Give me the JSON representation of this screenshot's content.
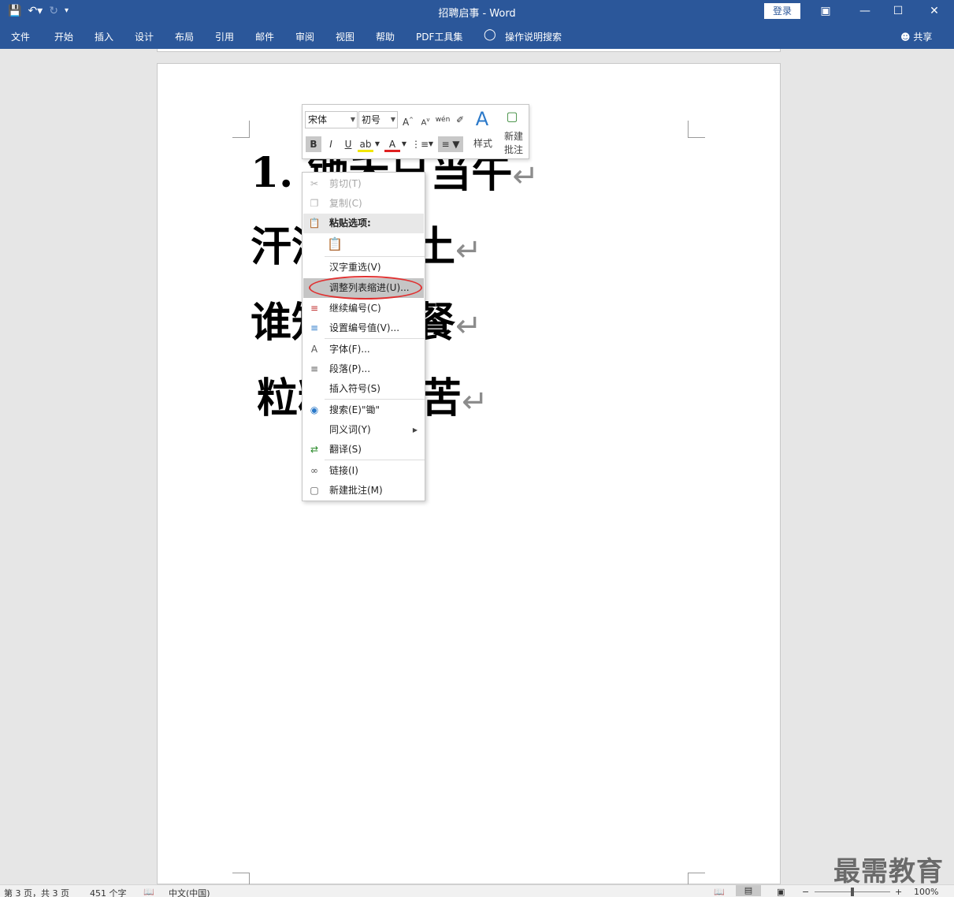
{
  "title_bar": {
    "document_title": "招聘启事  -  Word",
    "login_label": "登录",
    "quick_access": [
      "save-icon",
      "undo-icon",
      "redo-icon",
      "customize-icon"
    ],
    "window_controls": [
      "ribbon-display-icon",
      "minimize-icon",
      "maximize-icon",
      "close-icon"
    ]
  },
  "ribbon": {
    "tabs": [
      "文件",
      "开始",
      "插入",
      "设计",
      "布局",
      "引用",
      "邮件",
      "审阅",
      "视图",
      "帮助",
      "PDF工具集"
    ],
    "tell_me": "操作说明搜索",
    "share": "共享"
  },
  "document": {
    "lines": [
      {
        "text": "1.  锄禾日当午"
      },
      {
        "text": "汗滴禾下土"
      },
      {
        "text": "谁知盘中餐"
      },
      {
        "text": "粒粒皆辛苦"
      }
    ],
    "return_mark": "↵"
  },
  "mini_toolbar": {
    "font_name": "宋体",
    "font_size": "初号",
    "styles_label": "样式",
    "new_comment_label_1": "新建",
    "new_comment_label_2": "批注"
  },
  "context_menu": {
    "items": [
      {
        "label": "剪切(T)",
        "icon": "scissors-icon",
        "disabled": true
      },
      {
        "label": "复制(C)",
        "icon": "copy-icon",
        "disabled": true
      },
      {
        "label": "粘贴选项:",
        "icon": "paste-icon",
        "section": true
      },
      {
        "label": "汉字重选(V)",
        "icon": ""
      },
      {
        "label": "调整列表缩进(U)...",
        "icon": "",
        "highlighted": true
      },
      {
        "label": "继续编号(C)",
        "icon": "continue-numbering-icon"
      },
      {
        "label": "设置编号值(V)...",
        "icon": "set-numbering-icon"
      },
      {
        "label": "字体(F)...",
        "icon": "font-icon"
      },
      {
        "label": "段落(P)...",
        "icon": "paragraph-icon"
      },
      {
        "label": "插入符号(S)",
        "icon": ""
      },
      {
        "label": "搜索(E)\"锄\"",
        "icon": "search-icon"
      },
      {
        "label": "同义词(Y)",
        "icon": "",
        "submenu": true
      },
      {
        "label": "翻译(S)",
        "icon": "translate-icon"
      },
      {
        "label": "链接(I)",
        "icon": "link-icon"
      },
      {
        "label": "新建批注(M)",
        "icon": "new-comment-icon"
      }
    ]
  },
  "watermark": "最需教育",
  "status_bar": {
    "page_info": "第 3 页，共 3 页",
    "word_count": "451 个字",
    "language": "中文(中国)",
    "zoom": "100%"
  }
}
